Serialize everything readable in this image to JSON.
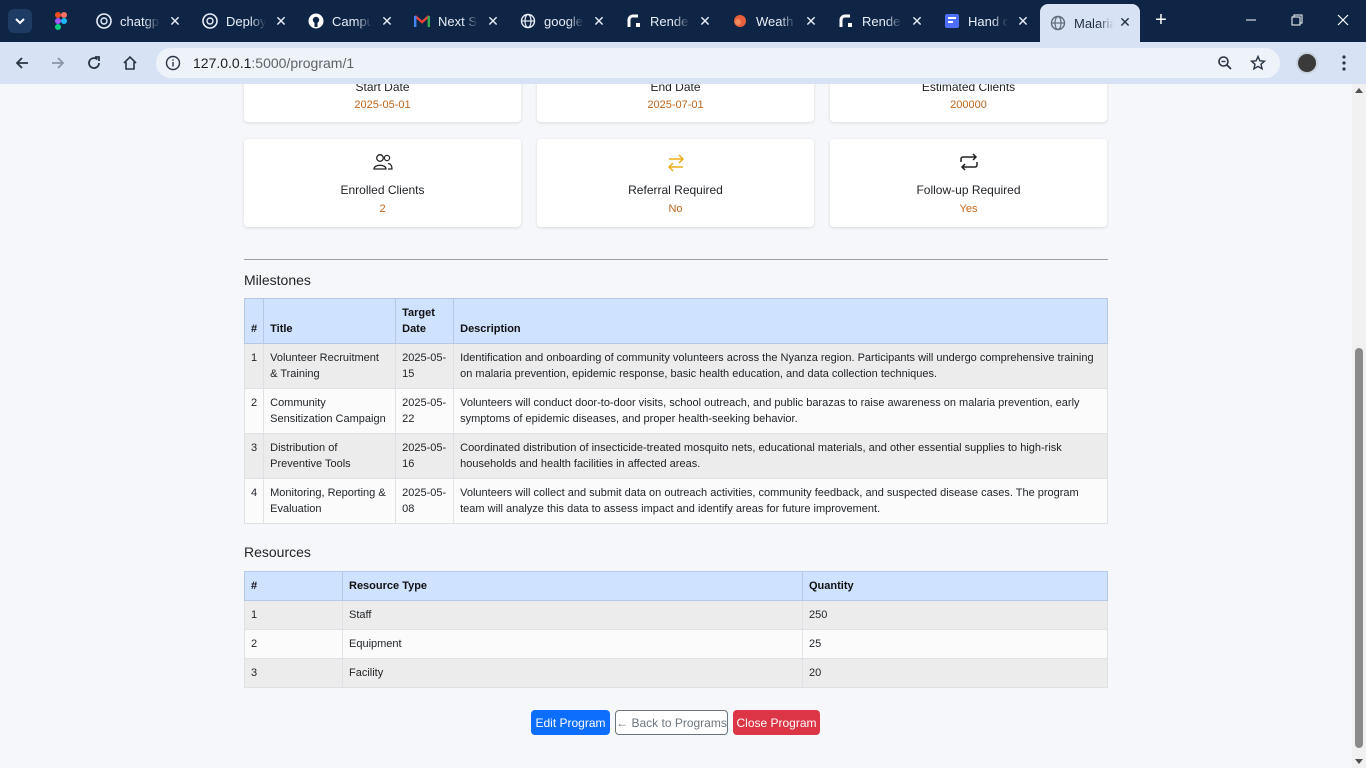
{
  "browser": {
    "tabs": [
      {
        "title": "chatgp",
        "icon": "openai-icon"
      },
      {
        "title": "Deploy",
        "icon": "openai-icon"
      },
      {
        "title": "Campu",
        "icon": "github-icon"
      },
      {
        "title": "Next S",
        "icon": "gmail-icon"
      },
      {
        "title": "google",
        "icon": "globe-icon"
      },
      {
        "title": "Rende",
        "icon": "render-icon"
      },
      {
        "title": "Weath",
        "icon": "weather-icon"
      },
      {
        "title": "Rende",
        "icon": "render-icon"
      },
      {
        "title": "Hand c",
        "icon": "forms-icon"
      },
      {
        "title": "Malaria",
        "icon": "globe-icon",
        "active": true
      }
    ],
    "url_host": "127.0.0.1",
    "url_path": ":5000/program/1"
  },
  "stats_top": [
    {
      "label": "Start Date",
      "value": "2025-05-01"
    },
    {
      "label": "End Date",
      "value": "2025-07-01"
    },
    {
      "label": "Estimated Clients",
      "value": "200000"
    }
  ],
  "stats": [
    {
      "label": "Enrolled Clients",
      "value": "2",
      "icon": "people-icon"
    },
    {
      "label": "Referral Required",
      "value": "No",
      "icon": "arrows-exchange-icon"
    },
    {
      "label": "Follow-up Required",
      "value": "Yes",
      "icon": "repeat-icon"
    }
  ],
  "milestones": {
    "title": "Milestones",
    "headers": [
      "#",
      "Title",
      "Target Date",
      "Description"
    ],
    "rows": [
      {
        "num": "1",
        "title": "Volunteer Recruitment & Training",
        "date": "2025-05-15",
        "desc": "Identification and onboarding of community volunteers across the Nyanza region. Participants will undergo comprehensive training on malaria prevention, epidemic response, basic health education, and data collection techniques."
      },
      {
        "num": "2",
        "title": "Community Sensitization Campaign",
        "date": "2025-05-22",
        "desc": "Volunteers will conduct door-to-door visits, school outreach, and public barazas to raise awareness on malaria prevention, early symptoms of epidemic diseases, and proper health-seeking behavior."
      },
      {
        "num": "3",
        "title": "Distribution of Preventive Tools",
        "date": "2025-05-16",
        "desc": "Coordinated distribution of insecticide-treated mosquito nets, educational materials, and other essential supplies to high-risk households and health facilities in affected areas."
      },
      {
        "num": "4",
        "title": "Monitoring, Reporting & Evaluation",
        "date": "2025-05-08",
        "desc": "Volunteers will collect and submit data on outreach activities, community feedback, and suspected disease cases. The program team will analyze this data to assess impact and identify areas for future improvement."
      }
    ]
  },
  "resources": {
    "title": "Resources",
    "headers": [
      "#",
      "Resource Type",
      "Quantity"
    ],
    "rows": [
      {
        "num": "1",
        "type": "Staff",
        "qty": "250"
      },
      {
        "num": "2",
        "type": "Equipment",
        "qty": "25"
      },
      {
        "num": "3",
        "type": "Facility",
        "qty": "20"
      }
    ]
  },
  "actions": {
    "edit": "Edit Program",
    "back": "← Back to Programs",
    "close": "Close Program"
  },
  "colors": {
    "accent_value": "#c0651a",
    "primary": "#0d6efd",
    "danger": "#dc3545",
    "table_header": "#cfe2ff"
  }
}
